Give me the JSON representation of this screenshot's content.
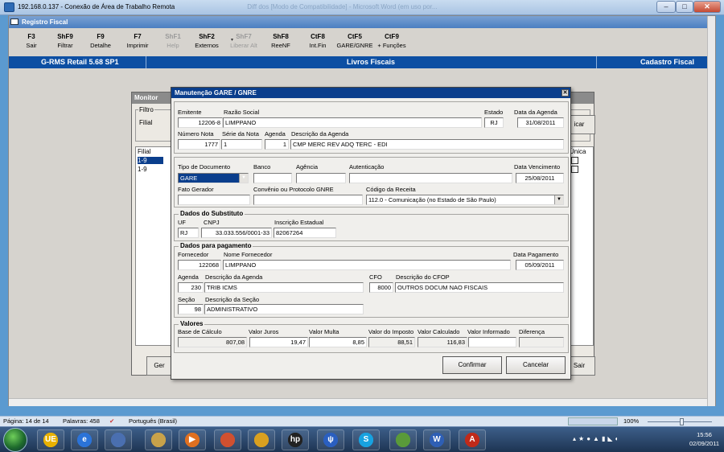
{
  "outer": {
    "title": "192.168.0.137 - Conexão de Área de Trabalho Remota",
    "ghost": "Diff dos [Modo de Compatibilidade] - Microsoft Word (em uso por..."
  },
  "app": {
    "title": "Registro Fiscal",
    "fkeys": [
      {
        "key": "F3",
        "label": "Sair",
        "disabled": false
      },
      {
        "key": "ShF9",
        "label": "Filtrar",
        "disabled": false
      },
      {
        "key": "F9",
        "label": "Detalhe",
        "disabled": false
      },
      {
        "key": "F7",
        "label": "Imprimir",
        "disabled": false
      },
      {
        "key": "ShF1",
        "label": "Help",
        "disabled": true
      },
      {
        "key": "ShF2",
        "label": "Externos",
        "disabled": false
      },
      {
        "key": "ShF7",
        "label": "Liberar Alt",
        "disabled": true
      },
      {
        "key": "ShF8",
        "label": "ReeNF",
        "disabled": false
      },
      {
        "key": "CtF8",
        "label": "Int.Fin",
        "disabled": false
      },
      {
        "key": "CtF5",
        "label": "GARE/GNRE",
        "disabled": false
      },
      {
        "key": "CtF9",
        "label": "+ Funções",
        "disabled": false
      }
    ],
    "bar_left": "G-RMS Retail 5.68 SP1",
    "bar_center": "Livros Fiscais",
    "bar_right": "Cadastro Fiscal"
  },
  "monitor": {
    "title": "Monitor",
    "filtro": "Filtro",
    "filial": "Filial",
    "col_filial": "Filial",
    "rows": [
      "1-9",
      "1-9"
    ],
    "col_unica": "Única",
    "btn_left": "Ger",
    "btn_right": "Sair",
    "btn_buscar": "icar"
  },
  "dialog": {
    "title": "Manutenção GARE / GNRE",
    "emitente_l": "Emitente",
    "emitente": "12206-8",
    "razao_l": "Razão Social",
    "razao": "LIMPPANO",
    "estado_l": "Estado",
    "estado": "RJ",
    "data_agenda_l": "Data da Agenda",
    "data_agenda": "31/08/2011",
    "numero_nota_l": "Número Nota",
    "numero_nota": "1777",
    "serie_l": "Série da Nota",
    "serie": "1",
    "agenda_l": "Agenda",
    "agenda": "1",
    "desc_agenda_l": "Descrição da Agenda",
    "desc_agenda": "CMP MERC REV ADQ TERC - EDI",
    "tipo_doc_l": "Tipo de Documento",
    "tipo_doc": "GARE",
    "banco_l": "Banco",
    "agencia_l": "Agência",
    "autenticacao_l": "Autenticação",
    "data_venc_l": "Data Vencimento",
    "data_venc": "25/08/2011",
    "fato_l": "Fato Gerador",
    "convenio_l": "Convênio ou Protocolo GNRE",
    "cod_receita_l": "Código da Receita",
    "cod_receita": "112.0 - Comunicação (no Estado de São Paulo)",
    "subst_t": "Dados do Substituto",
    "uf_l": "UF",
    "uf": "RJ",
    "cnpj_l": "CNPJ",
    "cnpj": "33.033.556/0001-33",
    "ie_l": "Inscrição Estadual",
    "ie": "82067264",
    "pag_t": "Dados para pagamento",
    "fornecedor_l": "Fornecedor",
    "fornecedor": "122068",
    "nome_forn_l": "Nome Fornecedor",
    "nome_forn": "LIMPPANO",
    "data_pag_l": "Data Pagamento",
    "data_pag": "05/09/2011",
    "agenda2_l": "Agenda",
    "agenda2": "230",
    "desc_agenda2_l": "Descrição da Agenda",
    "desc_agenda2": "TRIB ICMS",
    "cfo_l": "CFO",
    "cfo": "8000",
    "desc_cfop_l": "Descrição do CFOP",
    "desc_cfop": "OUTROS DOCUM NAO FISCAIS",
    "secao_l": "Seção",
    "secao": "98",
    "desc_secao_l": "Descrição da Seção",
    "desc_secao": "ADMINISTRATIVO",
    "valores_t": "Valores",
    "base_l": "Base de Cálculo",
    "base": "807,08",
    "juros_l": "Valor Juros",
    "juros": "19,47",
    "multa_l": "Valor Multa",
    "multa": "8,85",
    "imposto_l": "Valor do Imposto",
    "imposto": "88,51",
    "calculado_l": "Valor Calculado",
    "calculado": "116,83",
    "informado_l": "Valor Informado",
    "diferenca_l": "Diferença",
    "confirmar": "Confirmar",
    "cancelar": "Cancelar"
  },
  "status": {
    "pagina": "Página: 14 de 14",
    "palavras": "Palavras: 458",
    "idioma": "Português (Brasil)",
    "zoom": "100%"
  },
  "clock": {
    "time": "15:56",
    "date": "02/09/2011"
  },
  "taskbar": [
    "UE",
    "e",
    "",
    "",
    "▶",
    "",
    "",
    "hp",
    "ψ",
    "S",
    "",
    "W",
    "A"
  ]
}
